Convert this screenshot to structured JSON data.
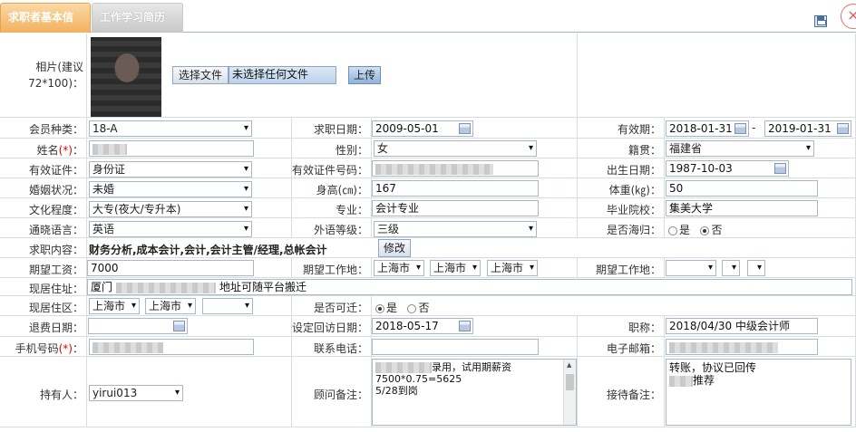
{
  "tabs": {
    "basic": "求职者基本信息",
    "resume": "工作学习简历"
  },
  "icons": {
    "save": "save-icon",
    "close": "close-icon"
  },
  "photo": {
    "label": "相片(建议72*100)：",
    "choose_button": "选择文件",
    "file_status": "未选择任何文件",
    "upload_button": "上传"
  },
  "labels": {
    "member_type": "会员种类：",
    "apply_date": "求职日期：",
    "valid_period": "有效期：",
    "name": "姓名",
    "gender": "性别：",
    "native": "籍贯：",
    "id_type": "有效证件：",
    "id_no": "有效证件号码：",
    "birth": "出生日期：",
    "marital": "婚姻状况：",
    "height": "身高(㎝)：",
    "weight": "体重(㎏)：",
    "education": "文化程度：",
    "major": "专业：",
    "school": "毕业院校：",
    "language": "通晓语言：",
    "lang_level": "外语等级：",
    "overseas": "是否海归：",
    "job_content": "求职内容：",
    "salary": "期望工资：",
    "expect_loc": "期望工作地：",
    "expect_loc2": "期望工作地：",
    "address": "现居住址：",
    "residence": "现居住区：",
    "relocate": "是否可迁：",
    "refund": "退费日期：",
    "revisit": "设定回访日期：",
    "title": "职称：",
    "mobile": "手机号码",
    "phone": "联系电话：",
    "email": "电子邮箱：",
    "holder": "持有人：",
    "advisor_note": "顾问备注：",
    "reception_note": "接待备注：",
    "req_mark": "(*)",
    "colon": "："
  },
  "values": {
    "member_type": "18-A",
    "apply_date": "2009-05-01",
    "valid_from": "2018-01-31",
    "valid_sep": "-",
    "valid_to": "2019-01-31",
    "gender": "女",
    "native": "福建省",
    "id_type": "身份证",
    "birth": "1987-10-03",
    "marital": "未婚",
    "height": "167",
    "weight": "50",
    "education": "大专(夜大/专升本)",
    "major": "会计专业",
    "school": "集美大学",
    "language": "英语",
    "lang_level": "三级",
    "overseas_yes": "是",
    "overseas_no": "否",
    "job_content": "财务分析,成本会计,会计,会计主管/经理,总帐会计",
    "modify_button": "修改",
    "salary": "7000",
    "expect_city1": "上海市",
    "expect_city2": "上海市",
    "expect_city3": "上海市",
    "address_prefix": "厦门",
    "address_suffix": "地址可随平台搬迁",
    "res_city1": "上海市",
    "res_city2": "上海市",
    "relocate_yes": "是",
    "relocate_no": "否",
    "revisit": "2018-05-17",
    "title": "2018/04/30 中级会计师",
    "holder": "yirui013",
    "advisor_line1": "录用，试用期薪资",
    "advisor_line2": "7500*0.75=5625",
    "advisor_line3": "5/28到岗",
    "reception_line1": "转账，协议已回传",
    "reception_line2": "推荐"
  }
}
